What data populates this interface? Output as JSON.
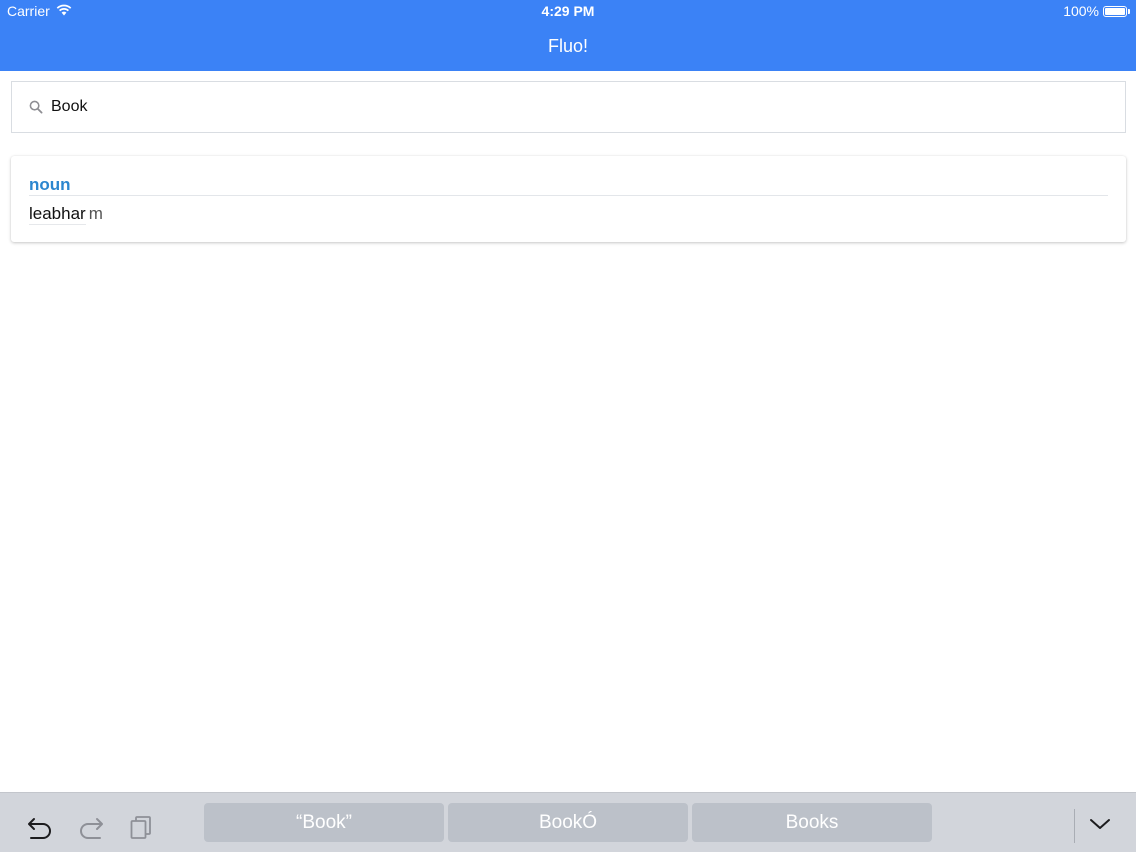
{
  "status_bar": {
    "carrier": "Carrier",
    "time": "4:29 PM",
    "battery": "100%",
    "icons": [
      "wifi-icon",
      "battery-icon"
    ]
  },
  "nav": {
    "title": "Fluo!"
  },
  "search": {
    "value": "Book",
    "placeholder": "",
    "icon": "search-icon"
  },
  "results": [
    {
      "part_of_speech": "noun",
      "word": "leabhar",
      "gender": "m"
    }
  ],
  "keyboard_bar": {
    "tools": [
      "undo-icon",
      "redo-icon",
      "paste-icon"
    ],
    "suggestions": [
      "“Book”",
      "BookÓ",
      "Books"
    ],
    "dismiss_icon": "chevron-down-icon"
  },
  "colors": {
    "header": "#3b82f6",
    "pos_label": "#2b86cf",
    "keyboard_bg": "#d2d5db",
    "suggestion_bg": "#bcc1c9"
  }
}
